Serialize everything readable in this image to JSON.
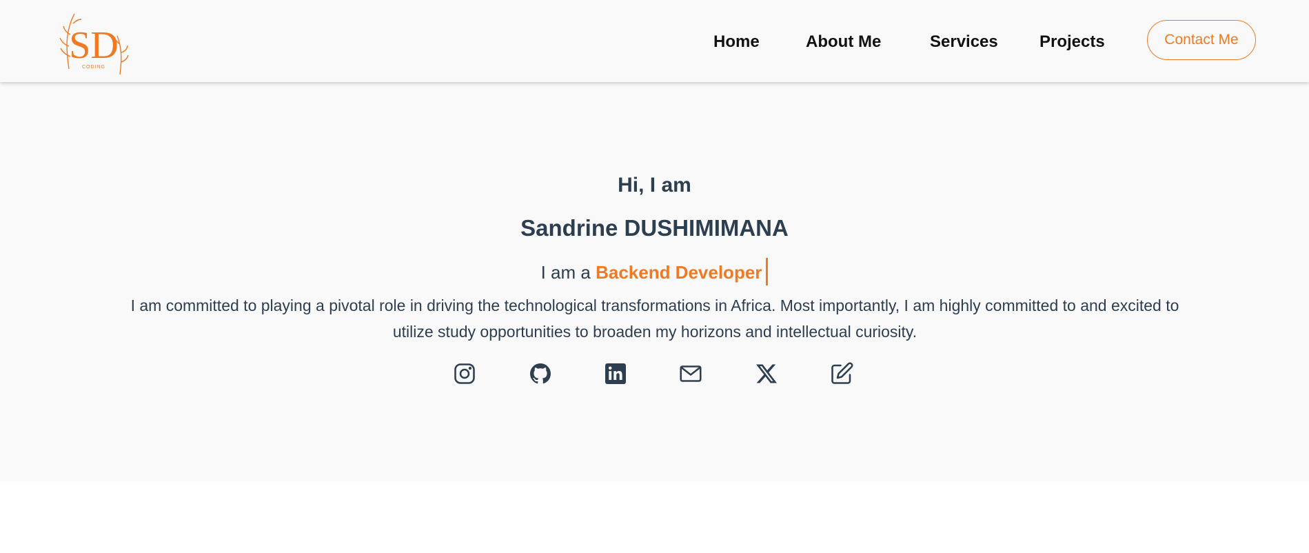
{
  "header": {
    "logo_alt": "SD CODING",
    "logo_text": "SD",
    "logo_subtext": "CODING",
    "nav": [
      {
        "label": "Home"
      },
      {
        "label": "About Me"
      },
      {
        "label": "Services"
      },
      {
        "label": "Projects"
      }
    ],
    "contact_label": "Contact Me"
  },
  "hero": {
    "greeting": "Hi, I am",
    "name": "Sandrine DUSHIMIMANA",
    "role_prefix": "I am a",
    "role_highlight": "Backend Developer",
    "bio": "I am committed to playing a pivotal role in driving the technological transformations in Africa. Most importantly, I am highly committed to and excited to utilize study opportunities to broaden my horizons and intellectual curiosity.",
    "socials": [
      {
        "icon": "instagram-icon"
      },
      {
        "icon": "github-icon"
      },
      {
        "icon": "linkedin-icon"
      },
      {
        "icon": "mail-icon"
      },
      {
        "icon": "x-icon"
      },
      {
        "icon": "edit-icon"
      }
    ]
  },
  "colors": {
    "accent": "#f07a24",
    "text": "#2c3e50",
    "background": "#f9f9f9"
  }
}
